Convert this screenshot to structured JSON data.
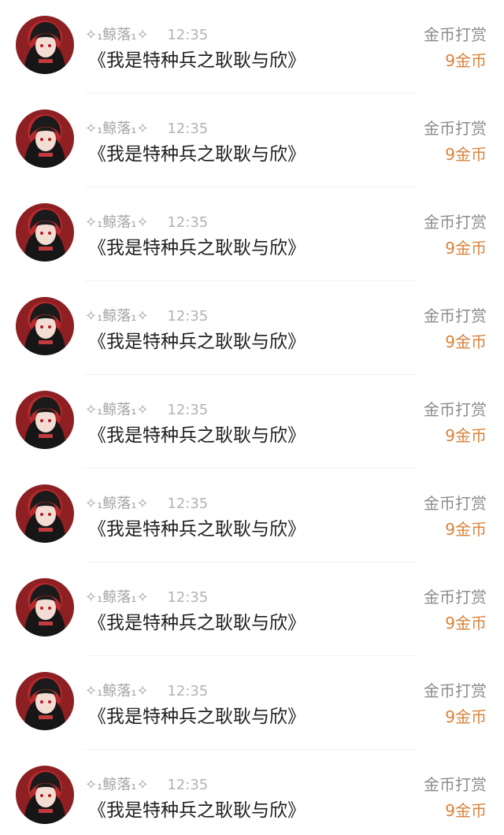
{
  "records": [
    {
      "user": "✧₁鲸落₁✧",
      "time": "12:35",
      "title": "《我是特种兵之耿耿与欣》",
      "reward_label": "金币打赏",
      "reward_amount": "9金币"
    },
    {
      "user": "✧₁鲸落₁✧",
      "time": "12:35",
      "title": "《我是特种兵之耿耿与欣》",
      "reward_label": "金币打赏",
      "reward_amount": "9金币"
    },
    {
      "user": "✧₁鲸落₁✧",
      "time": "12:35",
      "title": "《我是特种兵之耿耿与欣》",
      "reward_label": "金币打赏",
      "reward_amount": "9金币"
    },
    {
      "user": "✧₁鲸落₁✧",
      "time": "12:35",
      "title": "《我是特种兵之耿耿与欣》",
      "reward_label": "金币打赏",
      "reward_amount": "9金币"
    },
    {
      "user": "✧₁鲸落₁✧",
      "time": "12:35",
      "title": "《我是特种兵之耿耿与欣》",
      "reward_label": "金币打赏",
      "reward_amount": "9金币"
    },
    {
      "user": "✧₁鲸落₁✧",
      "time": "12:35",
      "title": "《我是特种兵之耿耿与欣》",
      "reward_label": "金币打赏",
      "reward_amount": "9金币"
    },
    {
      "user": "✧₁鲸落₁✧",
      "time": "12:35",
      "title": "《我是特种兵之耿耿与欣》",
      "reward_label": "金币打赏",
      "reward_amount": "9金币"
    },
    {
      "user": "✧₁鲸落₁✧",
      "time": "12:35",
      "title": "《我是特种兵之耿耿与欣》",
      "reward_label": "金币打赏",
      "reward_amount": "9金币"
    },
    {
      "user": "✧₁鲸落₁✧",
      "time": "12:35",
      "title": "《我是特种兵之耿耿与欣》",
      "reward_label": "金币打赏",
      "reward_amount": "9金币"
    }
  ],
  "colors": {
    "reward_amount": "#d9823b",
    "reward_label": "#8c8c8c",
    "title": "#1f1f1f",
    "meta": "#a3a3a3"
  },
  "icons": {
    "avatar": "user-avatar-illustration"
  }
}
